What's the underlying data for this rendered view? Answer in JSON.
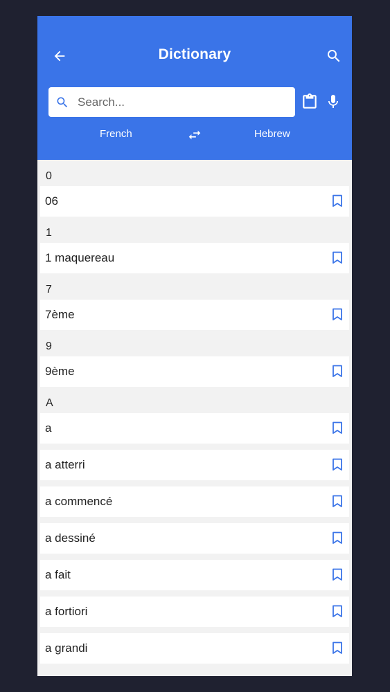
{
  "header": {
    "title": "Dictionary",
    "back_icon": "arrow-left-icon",
    "search_icon": "search-icon"
  },
  "search": {
    "placeholder": "Search...",
    "value": ""
  },
  "languages": {
    "from": "French",
    "to": "Hebrew"
  },
  "sections": [
    {
      "header": "0",
      "items": [
        "06"
      ]
    },
    {
      "header": "1",
      "items": [
        "1 maquereau"
      ]
    },
    {
      "header": "7",
      "items": [
        "7ème"
      ]
    },
    {
      "header": "9",
      "items": [
        "9ème"
      ]
    },
    {
      "header": "A",
      "items": [
        "a",
        "a atterri",
        "a commencé",
        "a dessiné",
        "a fait",
        "a fortiori",
        "a grandi"
      ]
    }
  ],
  "colors": {
    "accent": "#3a74e8",
    "background": "#f2f2f2",
    "frame": "#1f2130"
  }
}
